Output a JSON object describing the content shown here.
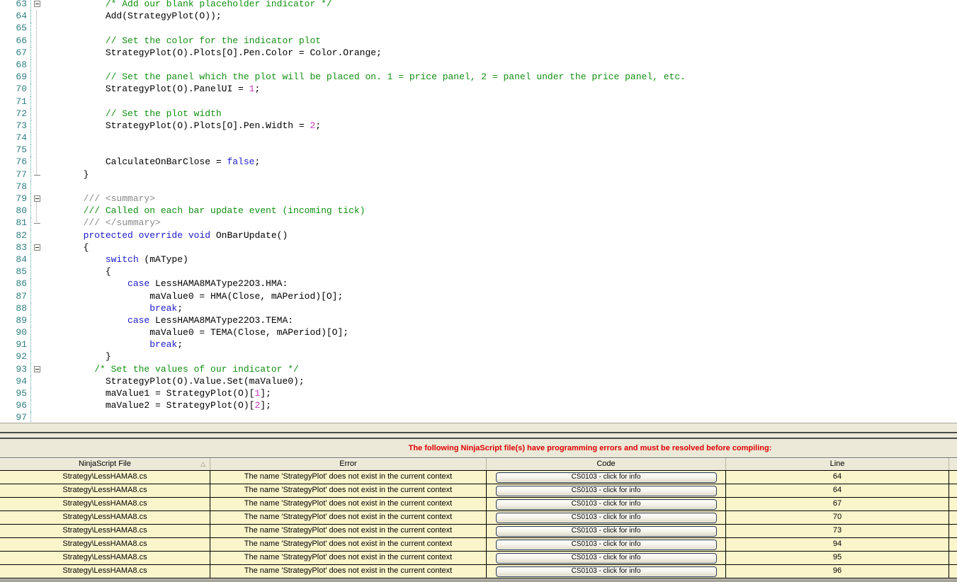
{
  "editor": {
    "visible_line_range": "63-97",
    "lines": [
      {
        "n": "63",
        "fold": "open",
        "segs": [
          {
            "t": "           /* Add our blank placeholder indicator */",
            "c": "cmt"
          }
        ]
      },
      {
        "n": "64",
        "fold": "",
        "segs": [
          {
            "t": "           Add(StrategyPlot(O));",
            "c": "code"
          }
        ]
      },
      {
        "n": "65",
        "fold": "",
        "segs": []
      },
      {
        "n": "66",
        "fold": "",
        "segs": [
          {
            "t": "           // Set the color for the indicator plot",
            "c": "cmt"
          }
        ]
      },
      {
        "n": "67",
        "fold": "",
        "segs": [
          {
            "t": "           StrategyPlot(O).Plots[O].Pen.Color = Color.Orange;",
            "c": "code"
          }
        ]
      },
      {
        "n": "68",
        "fold": "",
        "segs": []
      },
      {
        "n": "69",
        "fold": "",
        "segs": [
          {
            "t": "           // Set the panel which the plot will be placed on. 1 = price panel, 2 = panel under the price panel, etc.",
            "c": "cmt"
          }
        ]
      },
      {
        "n": "70",
        "fold": "",
        "segs": [
          {
            "t": "           StrategyPlot(O).PanelUI = ",
            "c": "code"
          },
          {
            "t": "1",
            "c": "num"
          },
          {
            "t": ";",
            "c": "code"
          }
        ]
      },
      {
        "n": "71",
        "fold": "",
        "segs": []
      },
      {
        "n": "72",
        "fold": "",
        "segs": [
          {
            "t": "           // Set the plot width",
            "c": "cmt"
          }
        ]
      },
      {
        "n": "73",
        "fold": "",
        "segs": [
          {
            "t": "           StrategyPlot(O).Plots[O].Pen.Width = ",
            "c": "code"
          },
          {
            "t": "2",
            "c": "num"
          },
          {
            "t": ";",
            "c": "code"
          }
        ]
      },
      {
        "n": "74",
        "fold": "",
        "segs": []
      },
      {
        "n": "75",
        "fold": "",
        "segs": []
      },
      {
        "n": "76",
        "fold": "",
        "segs": [
          {
            "t": "           CalculateOnBarClose = ",
            "c": "code"
          },
          {
            "t": "false",
            "c": "kw"
          },
          {
            "t": ";",
            "c": "code"
          }
        ]
      },
      {
        "n": "77",
        "fold": "end",
        "segs": [
          {
            "t": "       }",
            "c": "code"
          }
        ]
      },
      {
        "n": "78",
        "fold": "",
        "segs": []
      },
      {
        "n": "79",
        "fold": "open",
        "segs": [
          {
            "t": "       /// <summary>",
            "c": "doc"
          }
        ]
      },
      {
        "n": "80",
        "fold": "",
        "segs": [
          {
            "t": "       /// Called on each bar update event (incoming tick)",
            "c": "cmt"
          }
        ]
      },
      {
        "n": "81",
        "fold": "end",
        "segs": [
          {
            "t": "       /// </summary>",
            "c": "doc"
          }
        ]
      },
      {
        "n": "82",
        "fold": "",
        "segs": [
          {
            "t": "       protected override void ",
            "c": "kw"
          },
          {
            "t": "OnBarUpdate()",
            "c": "code"
          }
        ]
      },
      {
        "n": "83",
        "fold": "open",
        "segs": [
          {
            "t": "       {",
            "c": "code"
          }
        ]
      },
      {
        "n": "84",
        "fold": "",
        "segs": [
          {
            "t": "           switch",
            "c": "kw"
          },
          {
            "t": " (mAType)",
            "c": "code"
          }
        ]
      },
      {
        "n": "85",
        "fold": "",
        "segs": [
          {
            "t": "           {",
            "c": "code"
          }
        ]
      },
      {
        "n": "86",
        "fold": "",
        "segs": [
          {
            "t": "               case",
            "c": "kw"
          },
          {
            "t": " LessHAMA8MAType22O3.HMA:",
            "c": "code"
          }
        ]
      },
      {
        "n": "87",
        "fold": "",
        "segs": [
          {
            "t": "                   maValue0 = HMA(Close, mAPeriod)[O];",
            "c": "code"
          }
        ]
      },
      {
        "n": "88",
        "fold": "",
        "segs": [
          {
            "t": "                   break",
            "c": "kw"
          },
          {
            "t": ";",
            "c": "code"
          }
        ]
      },
      {
        "n": "89",
        "fold": "",
        "segs": [
          {
            "t": "               case",
            "c": "kw"
          },
          {
            "t": " LessHAMA8MAType22O3.TEMA:",
            "c": "code"
          }
        ]
      },
      {
        "n": "90",
        "fold": "",
        "segs": [
          {
            "t": "                   maValue0 = TEMA(Close, mAPeriod)[O];",
            "c": "code"
          }
        ]
      },
      {
        "n": "91",
        "fold": "",
        "segs": [
          {
            "t": "                   break",
            "c": "kw"
          },
          {
            "t": ";",
            "c": "code"
          }
        ]
      },
      {
        "n": "92",
        "fold": "",
        "segs": [
          {
            "t": "           }",
            "c": "code"
          }
        ]
      },
      {
        "n": "93",
        "fold": "open",
        "segs": [
          {
            "t": "         /* Set the values of our indicator */",
            "c": "cmt"
          }
        ]
      },
      {
        "n": "94",
        "fold": "",
        "segs": [
          {
            "t": "           StrategyPlot(O).Value.Set(maValue0);",
            "c": "code"
          }
        ]
      },
      {
        "n": "95",
        "fold": "",
        "segs": [
          {
            "t": "           maValue1 = StrategyPlot(O)[",
            "c": "code"
          },
          {
            "t": "1",
            "c": "num"
          },
          {
            "t": "];",
            "c": "code"
          }
        ]
      },
      {
        "n": "96",
        "fold": "",
        "segs": [
          {
            "t": "           maValue2 = StrategyPlot(O)[",
            "c": "code"
          },
          {
            "t": "2",
            "c": "num"
          },
          {
            "t": "];",
            "c": "code"
          }
        ]
      },
      {
        "n": "97",
        "fold": "",
        "segs": []
      }
    ]
  },
  "error_panel": {
    "banner": "The following NinjaScript file(s) have programming errors and must be resolved before compiling:",
    "columns": [
      "NinjaScript File",
      "Error",
      "Code",
      "Line"
    ],
    "rows": [
      {
        "file": "Strategy\\LessHAMA8.cs",
        "error": "The name 'StrategyPlot' does not exist in the current context",
        "code": "CS0103 - click for info",
        "line": "64"
      },
      {
        "file": "Strategy\\LessHAMA8.cs",
        "error": "The name 'StrategyPlot' does not exist in the current context",
        "code": "CS0103 - click for info",
        "line": "64"
      },
      {
        "file": "Strategy\\LessHAMA8.cs",
        "error": "The name 'StrategyPlot' does not exist in the current context",
        "code": "CS0103 - click for info",
        "line": "67"
      },
      {
        "file": "Strategy\\LessHAMA8.cs",
        "error": "The name 'StrategyPlot' does not exist in the current context",
        "code": "CS0103 - click for info",
        "line": "70"
      },
      {
        "file": "Strategy\\LessHAMA8.cs",
        "error": "The name 'StrategyPlot' does not exist in the current context",
        "code": "CS0103 - click for info",
        "line": "73"
      },
      {
        "file": "Strategy\\LessHAMA8.cs",
        "error": "The name 'StrategyPlot' does not exist in the current context",
        "code": "CS0103 - click for info",
        "line": "94"
      },
      {
        "file": "Strategy\\LessHAMA8.cs",
        "error": "The name 'StrategyPlot' does not exist in the current context",
        "code": "CS0103 - click for info",
        "line": "95"
      },
      {
        "file": "Strategy\\LessHAMA8.cs",
        "error": "The name 'StrategyPlot' does not exist in the current context",
        "code": "CS0103 - click for info",
        "line": "96"
      }
    ]
  },
  "icons": {
    "sort_ascending": "△",
    "fold_collapse": "minus-box",
    "fold_end": "dash"
  },
  "colors": {
    "banner_red": "#de0000",
    "row_yellow": "#fbf5cb",
    "panel_beige": "#ece9d8",
    "line_number_teal": "#2e7f7f",
    "syntax_comment_green": "#129012",
    "syntax_keyword_blue": "#1b1bcc",
    "syntax_number_magenta": "#c238c2",
    "syntax_doc_gray": "#8a8a8a"
  }
}
